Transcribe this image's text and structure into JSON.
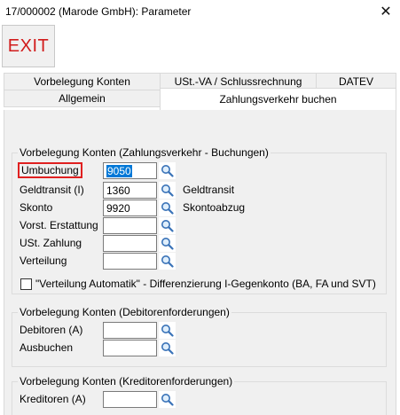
{
  "window": {
    "title": "17/000002 (Marode GmbH): Parameter",
    "close_glyph": "✕"
  },
  "toolbar": {
    "exit_label": "EXIT"
  },
  "tabs": {
    "row1": [
      "Vorbelegung Konten",
      "USt.-VA / Schlussrechnung",
      "DATEV"
    ],
    "row2": [
      "Allgemein",
      "Zahlungsverkehr buchen"
    ],
    "active": "Zahlungsverkehr buchen"
  },
  "group_zahlungsverkehr": {
    "title": "Vorbelegung Konten (Zahlungsverkehr - Buchungen)",
    "rows": [
      {
        "label": "Umbuchung",
        "value": "9050",
        "desc": ""
      },
      {
        "label": "Geldtransit (I)",
        "value": "1360",
        "desc": "Geldtransit"
      },
      {
        "label": "Skonto",
        "value": "9920",
        "desc": "Skontoabzug"
      },
      {
        "label": "Vorst. Erstattung",
        "value": "",
        "desc": ""
      },
      {
        "label": "USt. Zahlung",
        "value": "",
        "desc": ""
      },
      {
        "label": "Verteilung",
        "value": "",
        "desc": ""
      }
    ],
    "checkbox_label": "\"Verteilung Automatik\" - Differenzierung I-Gegenkonto (BA, FA und SVT)"
  },
  "group_debitoren": {
    "title": "Vorbelegung Konten (Debitorenforderungen)",
    "rows": [
      {
        "label": "Debitoren (A)",
        "value": ""
      },
      {
        "label": "Ausbuchen",
        "value": ""
      }
    ]
  },
  "group_kreditoren": {
    "title": "Vorbelegung Konten (Kreditorenforderungen)",
    "rows": [
      {
        "label": "Kreditoren (A)",
        "value": ""
      }
    ]
  },
  "icons": {
    "lookup": "magnifier-icon",
    "close": "close-icon"
  },
  "colors": {
    "exit_text": "#d11b1b",
    "highlight_border": "#e02020",
    "selection": "#0078d7",
    "panel_bg": "#f0f0f0"
  }
}
